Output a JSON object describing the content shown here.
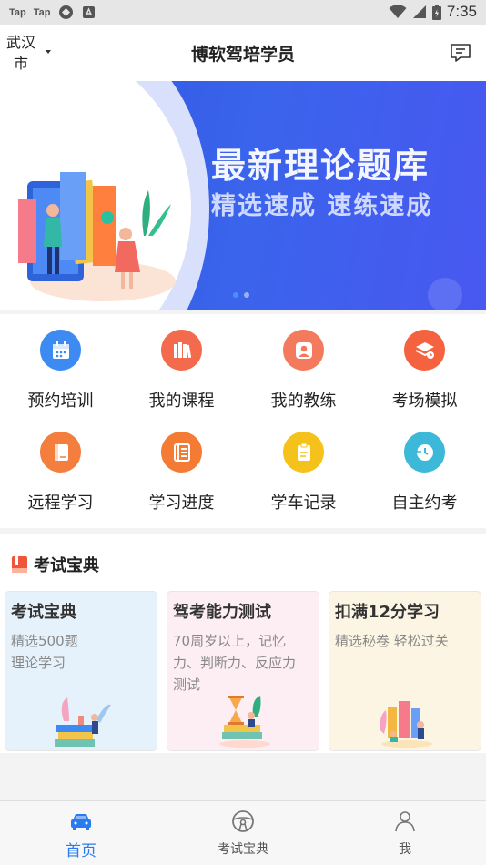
{
  "status_bar": {
    "left_items": [
      "Tap",
      "Tap"
    ],
    "time": "7:35"
  },
  "header": {
    "city": "武汉市",
    "city_line1": "武汉",
    "city_line2": "市",
    "title": "博软驾培学员",
    "message_icon": "message-icon"
  },
  "banner": {
    "headline": "最新理论题库",
    "subline": "精选速成 速练速成",
    "slides": 2,
    "active_slide": 1
  },
  "menu": {
    "items": [
      {
        "label": "预约培训",
        "icon": "calendar-icon",
        "color": "#3d8bf2"
      },
      {
        "label": "我的课程",
        "icon": "books-icon",
        "color": "#f46a4d"
      },
      {
        "label": "我的教练",
        "icon": "person-icon",
        "color": "#f47a5e"
      },
      {
        "label": "考场模拟",
        "icon": "layers-clock-icon",
        "color": "#f4623f"
      },
      {
        "label": "远程学习",
        "icon": "book-icon",
        "color": "#f47e3d"
      },
      {
        "label": "学习进度",
        "icon": "list-icon",
        "color": "#f37b33"
      },
      {
        "label": "学车记录",
        "icon": "notepad-icon",
        "color": "#f5c21c"
      },
      {
        "label": "自主约考",
        "icon": "history-icon",
        "color": "#3cb8d8"
      }
    ]
  },
  "exam": {
    "section_title": "考试宝典",
    "cards": [
      {
        "title": "考试宝典",
        "desc_lines": [
          "精选500题",
          "理论学习"
        ],
        "bg": "#e6f2fb"
      },
      {
        "title": "驾考能力测试",
        "desc_lines": [
          "70周岁以上，记忆",
          "力、判断力、反应力",
          "测试"
        ],
        "bg": "#fdeef3"
      },
      {
        "title": "扣满12分学习",
        "desc_lines": [
          "精选秘卷 轻松过关"
        ],
        "bg": "#fdf5e3"
      }
    ]
  },
  "tabbar": {
    "tabs": [
      {
        "label": "首页",
        "icon": "car-icon",
        "active": true
      },
      {
        "label": "考试宝典",
        "icon": "steering-wheel-icon",
        "active": false
      },
      {
        "label": "我",
        "icon": "user-icon",
        "active": false
      }
    ]
  },
  "colors": {
    "accent": "#2b7bf0",
    "banner_bg": "#3a5fe8"
  }
}
